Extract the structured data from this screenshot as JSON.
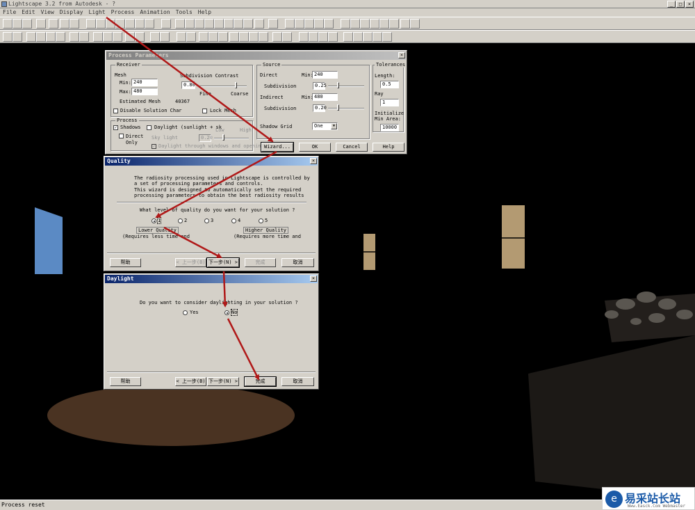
{
  "app": {
    "title": "Lightscape 3.2 from Autodesk - ?"
  },
  "menu": [
    "File",
    "Edit",
    "View",
    "Display",
    "Light",
    "Process",
    "Animation",
    "Tools",
    "Help"
  ],
  "statusbar": {
    "text": "Process reset"
  },
  "process_dialog": {
    "title": "Process Parameters",
    "receiver": {
      "label": "Receiver",
      "mesh": "Mesh",
      "min_label": "Min:",
      "min_value": "240",
      "max_label": "Max:",
      "max_value": "480",
      "subdiv_contrast": "Subdivision Contrast",
      "contrast_value": "0.80",
      "fine": "Fine",
      "coarse": "Coarse",
      "est_label": "Estimated Mesh",
      "est_value": "40367",
      "disable": "Disable Solution Char",
      "lock": "Lock Mesh"
    },
    "process": {
      "label": "Process",
      "shadows": "Shadows",
      "daylight": "Daylight (sunlight + sk",
      "direct": "Direct",
      "only": "Only",
      "skylight": "Sky light",
      "sky_value": "0.20",
      "low": "Low",
      "high": "High",
      "through": "Daylight through windows and opening"
    },
    "source": {
      "label": "Source",
      "direct": "Direct",
      "min": "Min:",
      "direct_min": "240",
      "subdivision": "Subdivision",
      "sub1": "0.25",
      "indirect": "Indirect",
      "indirect_min": "480",
      "sub2": "0.20",
      "shadow_grid": "Shadow Grid",
      "shadow_value": "One"
    },
    "tolerances": {
      "label": "Tolerances",
      "length": "Length:",
      "length_value": "0.5",
      "ray": "Ray",
      "ray_value": "1",
      "initial": "Initialize",
      "min_area": "Min Area:",
      "area_value": "10000"
    },
    "buttons": {
      "wizard": "Wizard...",
      "ok": "OK",
      "cancel": "Cancel",
      "help": "Help"
    }
  },
  "quality_dialog": {
    "title": "Quality",
    "desc1": "The radiosity processing used in Lightscape is controlled by",
    "desc2": "a set of processing parameters and controls.",
    "desc3": "This wizard is designed to automatically set the required",
    "desc4": "processing parameters to obtain the best radiosity results",
    "question": "What level of quality do you want for your solution ?",
    "levels": [
      "1",
      "2",
      "3",
      "4",
      "5"
    ],
    "lower": "Lower Quality",
    "lower_note": "(Requires less time and",
    "higher": "Higher Quality",
    "higher_note": "(Requires more time and",
    "help": "帮助",
    "back": "< 上一步(B)",
    "next": "下一步(N) >",
    "finish": "完成",
    "cancel": "取消"
  },
  "daylight_dialog": {
    "title": "Daylight",
    "question": "Do you want to consider daylighting in your solution ?",
    "yes": "Yes",
    "no": "No",
    "help": "帮助",
    "back": "< 上一步(B)",
    "next": "下一步(N) >",
    "finish": "完成",
    "cancel": "取消"
  },
  "watermark": {
    "logo": "e",
    "title": "易采站长站",
    "url": "Www.Easck.Com Webmaster"
  },
  "colors": {
    "arrow": "#b01818",
    "title_active": "#0a246a",
    "blue_panel": "#5b8ac4",
    "beige": "#b39a72",
    "brown_floor": "#4a3322",
    "dark_wall": "#1c1916"
  }
}
